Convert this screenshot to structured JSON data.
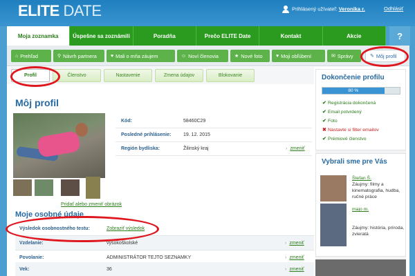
{
  "header": {
    "logo_elite": "ELITE",
    "logo_date": "DATE",
    "user_prefix": "Prihlásený užívateľ:",
    "user_name": "Veronika r.",
    "logout": "Odhlásiť"
  },
  "nav": {
    "items": [
      "Moja zoznamka",
      "Úspešne sa zoznámili",
      "Poradňa",
      "Prečo ELITE Date",
      "Kontakt",
      "Akcie"
    ],
    "help": "?"
  },
  "subnav": {
    "items": [
      {
        "label": "Prehľad",
        "icon": "home-icon"
      },
      {
        "label": "Návrh partnera",
        "icon": "search-icon"
      },
      {
        "label": "Mali o mňa záujem",
        "icon": "heart-icon"
      },
      {
        "label": "Noví členovia",
        "icon": "users-icon"
      },
      {
        "label": "Nové foto",
        "icon": "star-icon"
      },
      {
        "label": "Moji obľúbení",
        "icon": "heart-icon"
      },
      {
        "label": "Správy",
        "icon": "message-icon"
      },
      {
        "label": "Môj profil",
        "icon": "pencil-icon"
      }
    ]
  },
  "tabs": [
    "Profil",
    "Členstvo",
    "Nastavenie",
    "Zmena údajov",
    "Blokovanie"
  ],
  "profile": {
    "title": "Môj profil",
    "photo_link": "Pridať alebo zmeniť obrázok",
    "info": [
      {
        "label": "Kód:",
        "value": "58460C29",
        "change": ""
      },
      {
        "label": "Posledné prihlásenie:",
        "value": "19. 12. 2015",
        "change": ""
      },
      {
        "label": "Región bydliska:",
        "value": "Žilinský kraj",
        "change": "zmeniť"
      }
    ]
  },
  "personal": {
    "title": "Moje osobné údaje",
    "rows": [
      {
        "label": "Výsledok osobnostného testu:",
        "value": "Zobraziť výsledok",
        "change": ""
      },
      {
        "label": "Vzdelanie:",
        "value": "vysokoškolské",
        "change": "zmeniť"
      },
      {
        "label": "Povolanie:",
        "value": "ADMINISTRÁTOR TEJTO SEZNAMKY",
        "change": "zmeniť"
      },
      {
        "label": "Vek:",
        "value": "36",
        "change": "zmeniť"
      }
    ]
  },
  "completion": {
    "title": "Dokončenie profilu",
    "percent": 80,
    "percent_label": "80 %",
    "items": [
      {
        "label": "Registrácia dokončená",
        "ok": true
      },
      {
        "label": "Email potvrdený",
        "ok": true
      },
      {
        "label": "Foto",
        "ok": true
      },
      {
        "label": "Nastavte si filter emailov",
        "ok": false
      },
      {
        "label": "Prémiové členstvo",
        "ok": true
      }
    ]
  },
  "suggestions": {
    "title": "Vybrali sme pre Vás",
    "items": [
      {
        "name": "Štefan Š.",
        "text": "Záujmy: filmy a kinematografia, hudba, ručné práce"
      },
      {
        "name": "majo m.",
        "text": "Záujmy: história, príroda, zvieratá"
      }
    ]
  },
  "colors": {
    "accent_green": "#2b9b1f",
    "header_blue": "#1f7fbf",
    "annotation_red": "#e0161f"
  }
}
